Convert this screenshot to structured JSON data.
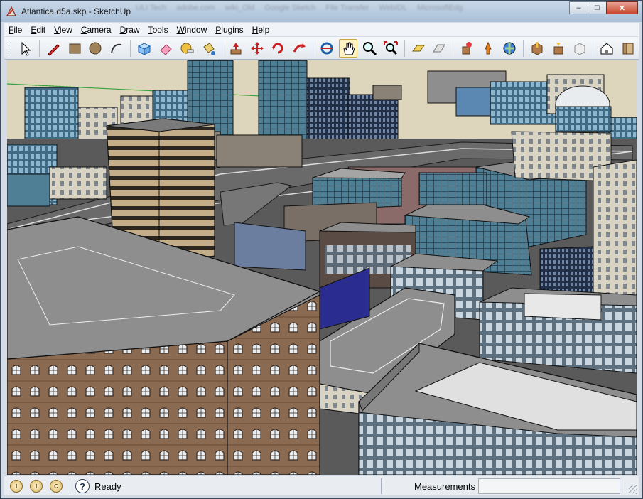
{
  "window": {
    "title": "Atlantica d5a.skp - SketchUp",
    "ghost_tabs": [
      "ULI Tech",
      "adobe.com",
      "wiki_Old",
      "Google Sketch",
      "File Transfer",
      "WebIDL",
      "MicrosoftEdg"
    ]
  },
  "menu": [
    {
      "label": "File",
      "hotkey": "F",
      "rest": "ile"
    },
    {
      "label": "Edit",
      "hotkey": "E",
      "rest": "dit"
    },
    {
      "label": "View",
      "hotkey": "V",
      "rest": "iew"
    },
    {
      "label": "Camera",
      "hotkey": "C",
      "rest": "amera"
    },
    {
      "label": "Draw",
      "hotkey": "D",
      "rest": "raw"
    },
    {
      "label": "Tools",
      "hotkey": "T",
      "rest": "ools"
    },
    {
      "label": "Window",
      "hotkey": "W",
      "rest": "indow"
    },
    {
      "label": "Plugins",
      "hotkey": "P",
      "rest": "lugins"
    },
    {
      "label": "Help",
      "hotkey": "H",
      "rest": "elp"
    }
  ],
  "toolbar": {
    "groups": [
      [
        "select-arrow-icon"
      ],
      [
        "pencil-line-icon",
        "rectangle-icon",
        "circle-icon",
        "arc-icon"
      ],
      [
        "make-component-icon",
        "eraser-icon",
        "tape-measure-icon",
        "paint-bucket-icon"
      ],
      [
        "push-pull-icon",
        "move-icon",
        "rotate-icon",
        "follow-me-icon"
      ],
      [
        "orbit-icon",
        "pan-hand-icon",
        "zoom-icon",
        "zoom-extents-icon"
      ],
      [
        "section-plane-icon",
        "display-section-icon"
      ],
      [
        "add-location-icon",
        "toggle-terrain-icon",
        "get-models-icon"
      ],
      [
        "share-model-icon",
        "share-component-icon",
        "get-photo-texture-icon"
      ],
      [
        "house-icon",
        "component-browser-icon"
      ]
    ],
    "active_tool": "pan-hand-icon"
  },
  "viewport": {
    "scene": "3d-city-model",
    "sky_color": "#ddd6bd",
    "ground_color": "#5a5a5a"
  },
  "status": {
    "geo_icons": [
      "G1",
      "G2",
      "G3"
    ],
    "help_glyph": "?",
    "message": "Ready",
    "measurements_label": "Measurements",
    "measurements_value": ""
  },
  "colors": {
    "titlebar": "#b8cde3",
    "close_button": "#c8472e",
    "roof_gray": "#8e8e8e",
    "glass_blue": "#4a7a96",
    "brick": "#8b6a52"
  }
}
